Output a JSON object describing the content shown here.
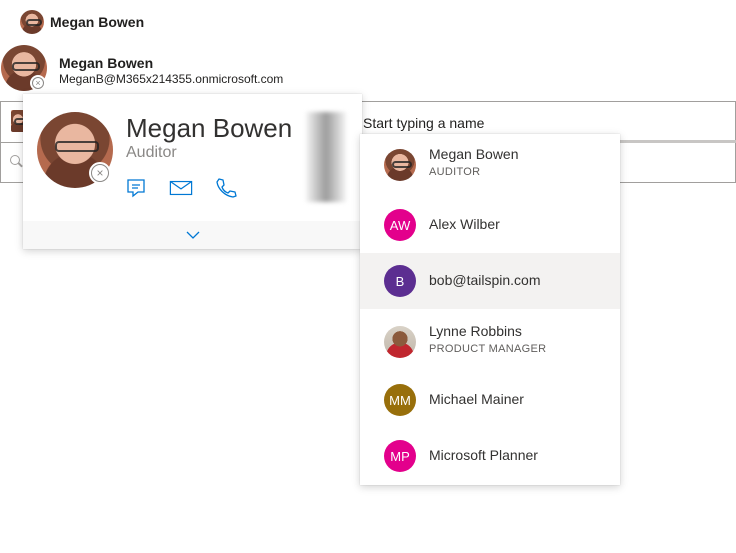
{
  "person_top": {
    "name": "Megan Bowen"
  },
  "person_two": {
    "name": "Megan Bowen",
    "email": "MeganB@M365x214355.onmicrosoft.com"
  },
  "person_card": {
    "name": "Megan Bowen",
    "title": "Auditor",
    "actions": [
      "chat-icon",
      "mail-icon",
      "phone-icon"
    ],
    "expand_icon": "chevron-down-icon"
  },
  "picker": {
    "placeholder": "Start typing a name",
    "search_icon": "search-icon"
  },
  "suggestions": [
    {
      "name": "Megan Bowen",
      "subtitle": "AUDITOR",
      "initials": "",
      "color": ""
    },
    {
      "name": "Alex Wilber",
      "subtitle": "",
      "initials": "AW",
      "color": "#e3008c"
    },
    {
      "name": "bob@tailspin.com",
      "subtitle": "",
      "initials": "B",
      "color": "#5c2e91"
    },
    {
      "name": "Lynne Robbins",
      "subtitle": "PRODUCT MANAGER",
      "initials": "",
      "color": ""
    },
    {
      "name": "Michael Mainer",
      "subtitle": "",
      "initials": "MM",
      "color": "#986f0b"
    },
    {
      "name": "Microsoft Planner",
      "subtitle": "",
      "initials": "MP",
      "color": "#e3008c"
    }
  ],
  "colors": {
    "accent": "#0078d4",
    "highlight": "#f3f2f1"
  }
}
